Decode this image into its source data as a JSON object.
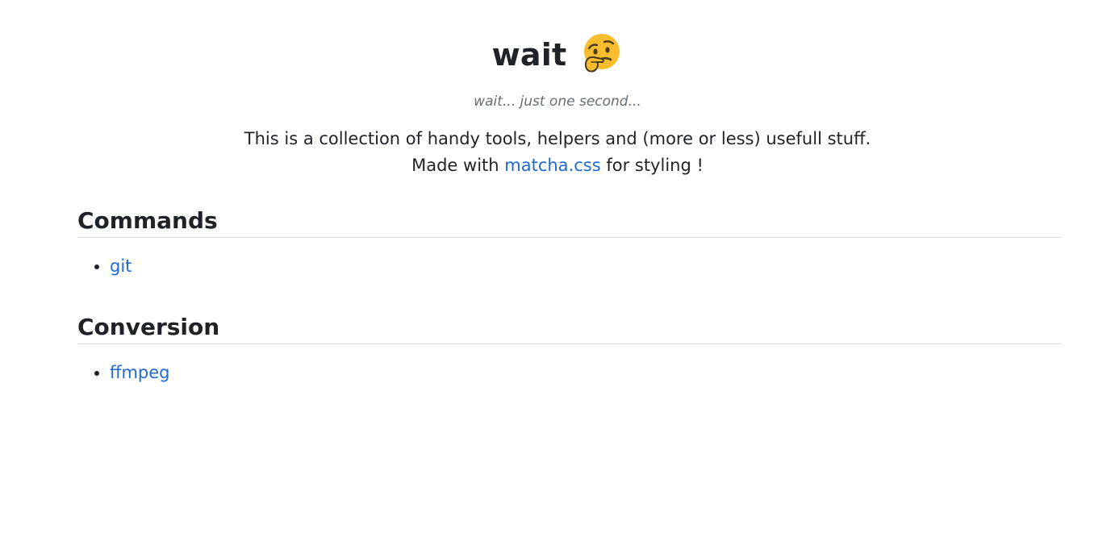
{
  "header": {
    "title": "wait",
    "emoji_icon": "thinking-face-icon",
    "tagline": "wait... just one second..."
  },
  "intro": {
    "line1": "This is a collection of handy tools, helpers and (more or less) usefull stuff.",
    "line2_prefix": "Made with ",
    "line2_link": "matcha.css",
    "line2_suffix": " for styling !"
  },
  "sections": [
    {
      "heading": "Commands",
      "items": [
        {
          "label": "git"
        }
      ]
    },
    {
      "heading": "Conversion",
      "items": [
        {
          "label": "ffmpeg"
        }
      ]
    }
  ],
  "colors": {
    "link": "#1f6bd1",
    "text": "#1f2328",
    "muted": "#656d76",
    "divider": "#d8dee4",
    "emoji_face": "#f7bd2e"
  }
}
